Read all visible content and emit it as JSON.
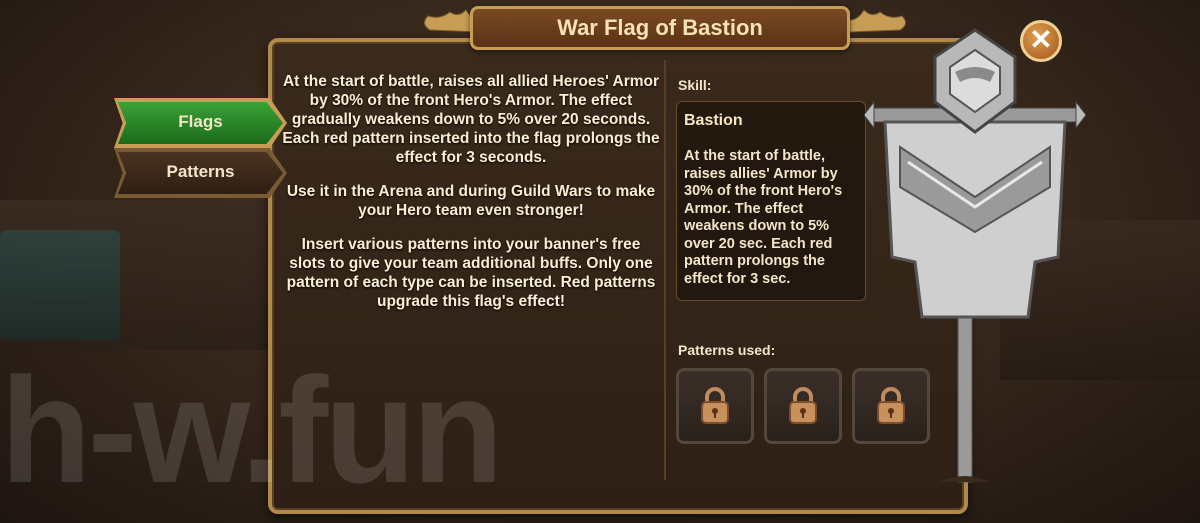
{
  "title": "War Flag of Bastion",
  "close_icon": "close-icon",
  "tabs": [
    {
      "label": "Flags",
      "active": true
    },
    {
      "label": "Patterns",
      "active": false
    }
  ],
  "description": {
    "p1": "At the start of battle, raises all allied Heroes' Armor by 30% of the front Hero's Armor. The effect gradually weakens down to 5% over 20 seconds. Each red pattern inserted into the flag prolongs the effect for 3 seconds.",
    "p2": "Use it in the Arena and during Guild Wars to make your Hero team even stronger!",
    "p3": "Insert various patterns into your banner's free slots to give your team additional buffs. Only one pattern of each type can be inserted. Red patterns upgrade this flag's effect!"
  },
  "skill": {
    "label": "Skill:",
    "name": "Bastion",
    "text": "At the start of battle, raises allies' Armor by 30% of the front Hero's Armor. The effect weakens down to 5% over 20 sec. Each red pattern prolongs the effect for 3 sec."
  },
  "patterns": {
    "label": "Patterns used:",
    "slots": [
      {
        "icon": "lock-icon",
        "locked": true
      },
      {
        "icon": "lock-icon",
        "locked": true
      },
      {
        "icon": "lock-icon",
        "locked": true
      }
    ]
  },
  "watermark": "h-w.fun",
  "colors": {
    "active_tab": "#2e8a2a",
    "frame": "#c79d55",
    "text": "#fbeed2"
  }
}
